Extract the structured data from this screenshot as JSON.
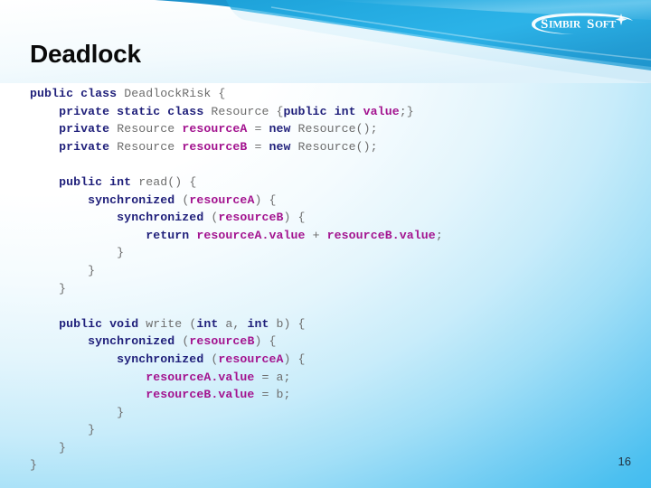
{
  "slide": {
    "title": "Deadlock",
    "number": "16",
    "logo_text": "SimbirSoft",
    "accent_color": "#29ABE2",
    "header_color_dark": "#1F9BD3",
    "header_color_light": "#4EC3EF",
    "keyword_color": "#1F1F7A",
    "identifier_color": "#A3138F",
    "plain_color": "#6D6D6D"
  },
  "code": {
    "language": "java",
    "lines": [
      [
        {
          "t": "public class ",
          "c": "kw"
        },
        {
          "t": "DeadlockRisk {",
          "c": "pl"
        }
      ],
      [
        {
          "t": "    ",
          "c": "pl"
        },
        {
          "t": "private static class ",
          "c": "kw"
        },
        {
          "t": "Resource {",
          "c": "pl"
        },
        {
          "t": "public int ",
          "c": "kw"
        },
        {
          "t": "value",
          "c": "id"
        },
        {
          "t": ";}",
          "c": "pl"
        }
      ],
      [
        {
          "t": "    ",
          "c": "pl"
        },
        {
          "t": "private ",
          "c": "kw"
        },
        {
          "t": "Resource ",
          "c": "pl"
        },
        {
          "t": "resourceA ",
          "c": "id"
        },
        {
          "t": "= ",
          "c": "pl"
        },
        {
          "t": "new ",
          "c": "kw"
        },
        {
          "t": "Resource();",
          "c": "pl"
        }
      ],
      [
        {
          "t": "    ",
          "c": "pl"
        },
        {
          "t": "private ",
          "c": "kw"
        },
        {
          "t": "Resource ",
          "c": "pl"
        },
        {
          "t": "resourceB ",
          "c": "id"
        },
        {
          "t": "= ",
          "c": "pl"
        },
        {
          "t": "new ",
          "c": "kw"
        },
        {
          "t": "Resource();",
          "c": "pl"
        }
      ],
      [
        {
          "t": "",
          "c": "pl"
        }
      ],
      [
        {
          "t": "    ",
          "c": "pl"
        },
        {
          "t": "public int ",
          "c": "kw"
        },
        {
          "t": "read() {",
          "c": "pl"
        }
      ],
      [
        {
          "t": "        ",
          "c": "pl"
        },
        {
          "t": "synchronized ",
          "c": "kw"
        },
        {
          "t": "(",
          "c": "pl"
        },
        {
          "t": "resourceA",
          "c": "id"
        },
        {
          "t": ") {",
          "c": "pl"
        }
      ],
      [
        {
          "t": "            ",
          "c": "pl"
        },
        {
          "t": "synchronized ",
          "c": "kw"
        },
        {
          "t": "(",
          "c": "pl"
        },
        {
          "t": "resourceB",
          "c": "id"
        },
        {
          "t": ") {",
          "c": "pl"
        }
      ],
      [
        {
          "t": "                ",
          "c": "pl"
        },
        {
          "t": "return ",
          "c": "kw"
        },
        {
          "t": "resourceA.value ",
          "c": "id"
        },
        {
          "t": "+ ",
          "c": "pl"
        },
        {
          "t": "resourceB.value",
          "c": "id"
        },
        {
          "t": ";",
          "c": "pl"
        }
      ],
      [
        {
          "t": "            }",
          "c": "pl"
        }
      ],
      [
        {
          "t": "        }",
          "c": "pl"
        }
      ],
      [
        {
          "t": "    }",
          "c": "pl"
        }
      ],
      [
        {
          "t": "",
          "c": "pl"
        }
      ],
      [
        {
          "t": "    ",
          "c": "pl"
        },
        {
          "t": "public void ",
          "c": "kw"
        },
        {
          "t": "write (",
          "c": "pl"
        },
        {
          "t": "int ",
          "c": "kw"
        },
        {
          "t": "a, ",
          "c": "pl"
        },
        {
          "t": "int ",
          "c": "kw"
        },
        {
          "t": "b) {",
          "c": "pl"
        }
      ],
      [
        {
          "t": "        ",
          "c": "pl"
        },
        {
          "t": "synchronized ",
          "c": "kw"
        },
        {
          "t": "(",
          "c": "pl"
        },
        {
          "t": "resourceB",
          "c": "id"
        },
        {
          "t": ") {",
          "c": "pl"
        }
      ],
      [
        {
          "t": "            ",
          "c": "pl"
        },
        {
          "t": "synchronized ",
          "c": "kw"
        },
        {
          "t": "(",
          "c": "pl"
        },
        {
          "t": "resourceA",
          "c": "id"
        },
        {
          "t": ") {",
          "c": "pl"
        }
      ],
      [
        {
          "t": "                ",
          "c": "pl"
        },
        {
          "t": "resourceA.value ",
          "c": "id"
        },
        {
          "t": "= a;",
          "c": "pl"
        }
      ],
      [
        {
          "t": "                ",
          "c": "pl"
        },
        {
          "t": "resourceB.value ",
          "c": "id"
        },
        {
          "t": "= b;",
          "c": "pl"
        }
      ],
      [
        {
          "t": "            }",
          "c": "pl"
        }
      ],
      [
        {
          "t": "        }",
          "c": "pl"
        }
      ],
      [
        {
          "t": "    }",
          "c": "pl"
        }
      ],
      [
        {
          "t": "}",
          "c": "pl"
        }
      ]
    ]
  }
}
